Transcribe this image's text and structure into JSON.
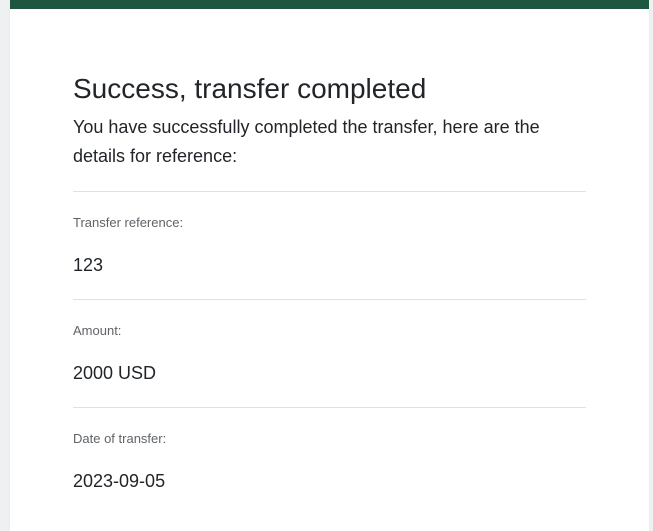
{
  "theme": {
    "accent": "#1e5640"
  },
  "confirmation": {
    "title": "Success, transfer completed",
    "intro": "You have successfully completed the transfer, here are the details for reference:",
    "details": [
      {
        "label": "Transfer reference:",
        "value": "123"
      },
      {
        "label": "Amount:",
        "value": "2000 USD"
      },
      {
        "label": "Date of transfer:",
        "value": "2023-09-05"
      }
    ]
  }
}
